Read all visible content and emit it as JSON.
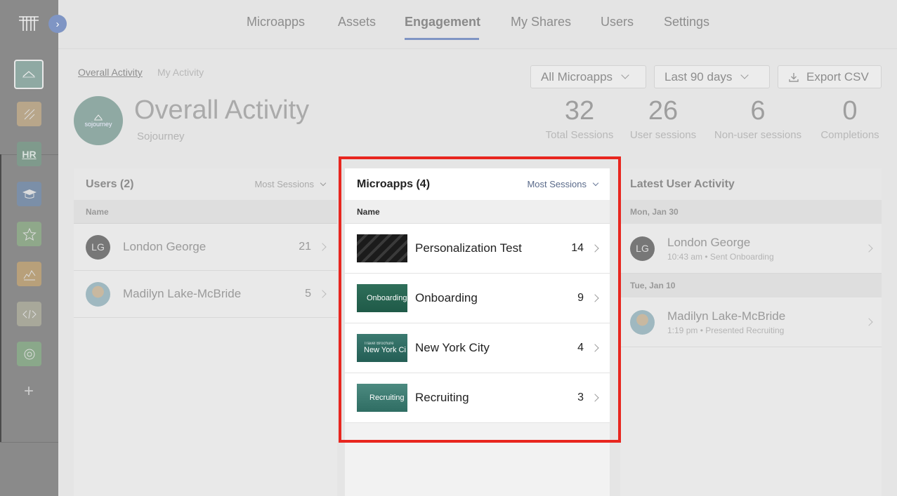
{
  "nav": {
    "tabs": [
      "Microapps",
      "Assets",
      "Engagement",
      "My Shares",
      "Users",
      "Settings"
    ],
    "active_tab": "Engagement"
  },
  "sublinks": {
    "overall": "Overall Activity",
    "mine": "My Activity"
  },
  "filters": {
    "microapps": "All Microapps",
    "range": "Last 90 days",
    "export": "Export CSV"
  },
  "header": {
    "title": "Overall Activity",
    "subtitle": "Sojourney",
    "logo_text": "sojourney"
  },
  "stats": [
    {
      "value": "32",
      "label": "Total Sessions"
    },
    {
      "value": "26",
      "label": "User sessions"
    },
    {
      "value": "6",
      "label": "Non-user sessions"
    },
    {
      "value": "0",
      "label": "Completions"
    }
  ],
  "rail": {
    "apps": [
      {
        "icon": "sojourney-app-icon",
        "color": "#8fa9a3"
      },
      {
        "icon": "pattern-app-icon",
        "color": "#b8a68a"
      },
      {
        "icon": "hr-app-icon",
        "color": "#7f9a8c",
        "label": "HR"
      },
      {
        "icon": "graduation-cap-app-icon",
        "color": "#7b8fa8"
      },
      {
        "icon": "star-app-icon",
        "color": "#8fa88a"
      },
      {
        "icon": "chart-app-icon",
        "color": "#b8a07a"
      },
      {
        "icon": "code-app-icon",
        "color": "#a8a89a"
      },
      {
        "icon": "gear-app-icon",
        "color": "#8aa88a"
      }
    ]
  },
  "users_panel": {
    "title": "Users (2)",
    "sort": "Most Sessions",
    "col_name": "Name",
    "rows": [
      {
        "initials": "LG",
        "name": "London George",
        "count": "21"
      },
      {
        "initials": "",
        "name": "Madilyn Lake-McBride",
        "count": "5"
      }
    ]
  },
  "microapps_panel": {
    "title": "Microapps (4)",
    "sort": "Most Sessions",
    "col_name": "Name",
    "rows": [
      {
        "name": "Personalization Test",
        "count": "14",
        "thumb_text": ""
      },
      {
        "name": "Onboarding",
        "count": "9",
        "thumb_text": "Onboarding"
      },
      {
        "name": "New York City",
        "count": "4",
        "thumb_text": "New York Ci",
        "thumb_sub": "Travel Brochure"
      },
      {
        "name": "Recruiting",
        "count": "3",
        "thumb_text": "Recruiting"
      }
    ]
  },
  "activity_panel": {
    "title": "Latest User Activity",
    "days": [
      {
        "date": "Mon, Jan 30",
        "initials": "LG",
        "name": "London George",
        "meta": "10:43 am • Sent Onboarding"
      },
      {
        "date": "Tue, Jan 10",
        "initials": "",
        "name": "Madilyn Lake-McBride",
        "meta": "1:19 pm • Presented Recruiting"
      }
    ]
  },
  "colors": {
    "accent": "#7f95c4",
    "highlight_border": "#e8261f"
  }
}
